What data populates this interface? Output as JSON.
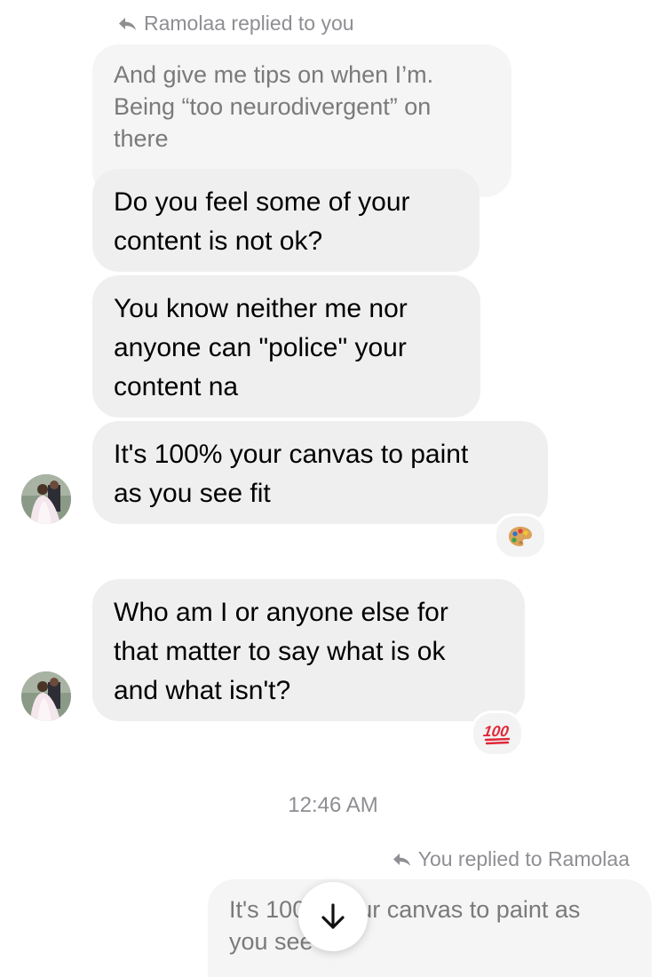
{
  "thread": {
    "incoming_reply_label": "Ramolaa replied to you",
    "incoming_quoted_lines": [
      "And give me tips on when I’m.",
      "Being “too neurodivergent” on",
      "there"
    ],
    "messages": [
      {
        "lines": [
          "Do you feel some of your",
          "content is not ok?"
        ]
      },
      {
        "lines": [
          "You know neither me nor",
          "anyone can \"police\" your",
          "content na"
        ]
      },
      {
        "lines": [
          "It's 100% your canvas to paint",
          "as you see fit"
        ],
        "reaction": "palette-emoji"
      },
      {
        "lines": [
          "Who am I or anyone else for",
          "that matter to say what is ok",
          "and what isn't?"
        ],
        "reaction": "hundred-points-emoji"
      }
    ],
    "timestamp": "12:46 AM",
    "outgoing_reply_label": "You replied to Ramolaa",
    "outgoing_quoted_lines": [
      "It's 100% your canvas to paint as",
      "you see fit"
    ]
  },
  "colors": {
    "bubble_incoming": "#efefef",
    "meta_text": "#8e8e93",
    "hundred_red": "#e0283a"
  },
  "icons": {
    "reply": "reply-arrow-icon",
    "scroll": "arrow-down-icon"
  }
}
